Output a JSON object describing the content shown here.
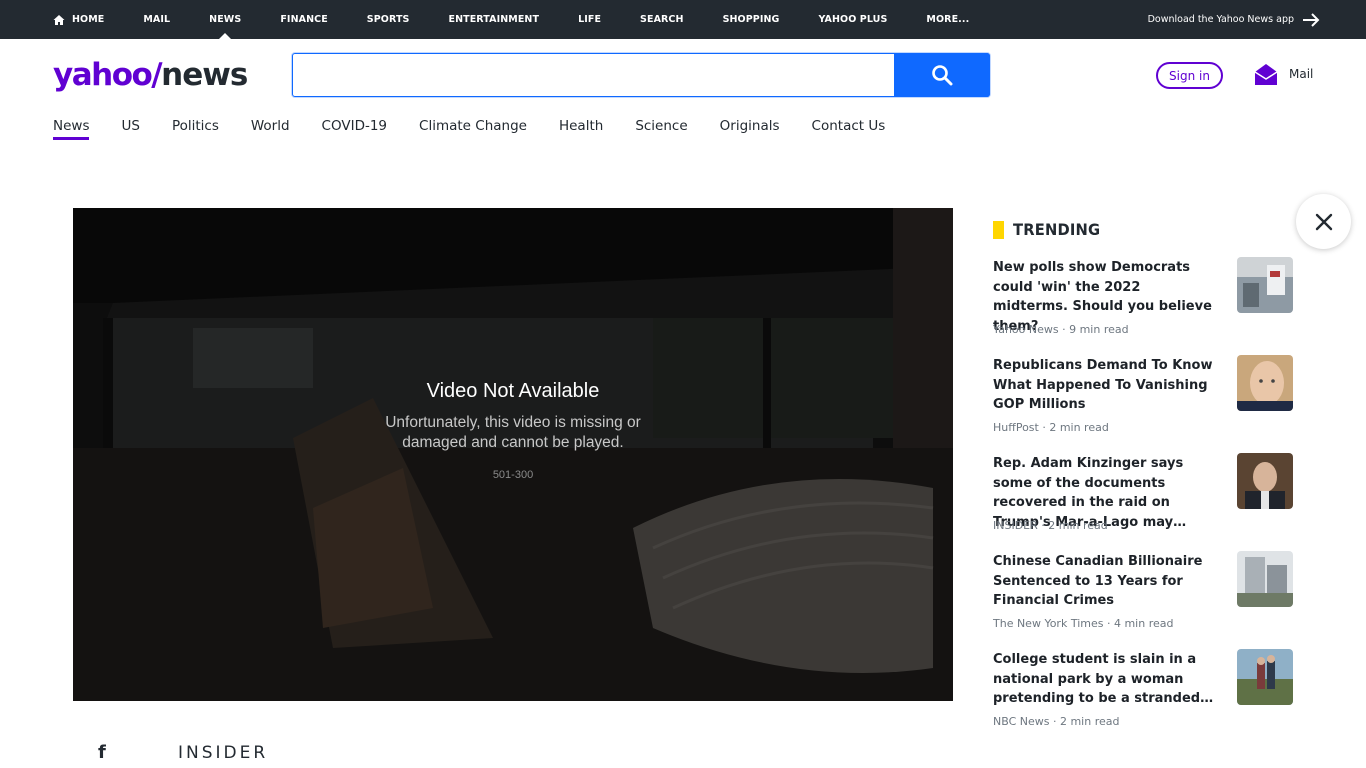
{
  "topnav": {
    "items": [
      "HOME",
      "MAIL",
      "NEWS",
      "FINANCE",
      "SPORTS",
      "ENTERTAINMENT",
      "LIFE",
      "SEARCH",
      "SHOPPING",
      "YAHOO PLUS",
      "MORE..."
    ],
    "active": "NEWS",
    "download_label": "Download the Yahoo News app"
  },
  "header": {
    "logo_yahoo": "yahoo/",
    "logo_news": "news",
    "search_placeholder": "",
    "sign_in_label": "Sign in",
    "mail_label": "Mail"
  },
  "subnav": {
    "items": [
      "News",
      "US",
      "Politics",
      "World",
      "COVID-19",
      "Climate Change",
      "Health",
      "Science",
      "Originals",
      "Contact Us"
    ],
    "active": "News"
  },
  "video": {
    "title": "Video Not Available",
    "message": "Unfortunately, this video is missing or damaged and cannot be played.",
    "code": "501-300"
  },
  "article": {
    "facebook_icon_glyph": "f",
    "source_logo": "INSIDER"
  },
  "trending": {
    "heading": "TRENDING",
    "items": [
      {
        "title": "New polls show Democrats could 'win' the 2022 midterms. Should you believe them?",
        "meta": "Yahoo News · 9 min read"
      },
      {
        "title": "Republicans Demand To Know What Happened To Vanishing GOP Millions",
        "meta": "HuffPost · 2 min read"
      },
      {
        "title": "Rep. Adam Kinzinger says some of the documents recovered in the raid on Trump's Mar-a-Lago may…",
        "meta": "INSIDER · 2 min read"
      },
      {
        "title": "Chinese Canadian Billionaire Sentenced to 13 Years for Financial Crimes",
        "meta": "The New York Times · 4 min read"
      },
      {
        "title": "College student is slain in a national park by a woman pretending to be a stranded…",
        "meta": "NBC News · 2 min read"
      }
    ]
  },
  "colors": {
    "topbar": "#232a31",
    "brand_purple": "#6001d2",
    "search_blue": "#0f69ff",
    "trending_yellow": "#ffd600"
  },
  "icons": [
    "home-icon",
    "arrow-right-icon",
    "search-icon",
    "mail-icon",
    "facebook-icon",
    "close-icon"
  ]
}
